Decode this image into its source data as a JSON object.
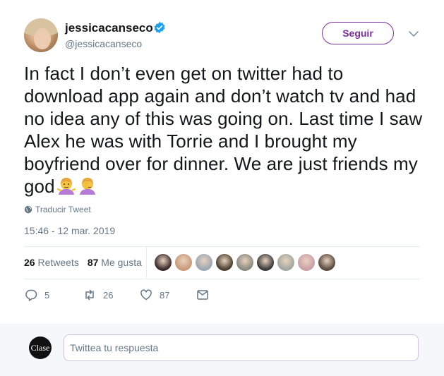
{
  "user": {
    "display_name": "jessicacanseco",
    "screen_name": "@jessicacanseco",
    "verified": true
  },
  "follow_button": {
    "label": "Seguir"
  },
  "tweet": {
    "text": "In fact I don’t even get on twitter had to download app again and don’t watch tv and had no idea any of this was going on.  Last time I saw Alex he was with Torrie and I brought my boyfriend over for dinner. We are just friends my god",
    "emojis": [
      "woman-shrugging-emoji",
      "woman-facepalming-emoji"
    ],
    "translate_label": "Traducir Tweet",
    "timestamp": "15:46 - 12 mar. 2019"
  },
  "stats": {
    "retweets_count": "26",
    "retweets_label": "Retweets",
    "likes_count": "87",
    "likes_label": "Me gusta"
  },
  "liker_avatars": [
    "#3a2a2a",
    "#c99a7a",
    "#9aa7b2",
    "#4a4030",
    "#8a8a80",
    "#3b3b3b",
    "#a0a8a0",
    "#c9a0a8",
    "#5a4a40"
  ],
  "actions": {
    "reply_count": "5",
    "retweet_count": "26",
    "like_count": "87"
  },
  "reply": {
    "avatar_text": "Clase",
    "placeholder": "Twittea tu respuesta"
  },
  "colors": {
    "accent": "#7b2f9e",
    "verified": "#1da1f2",
    "muted": "#657786"
  }
}
